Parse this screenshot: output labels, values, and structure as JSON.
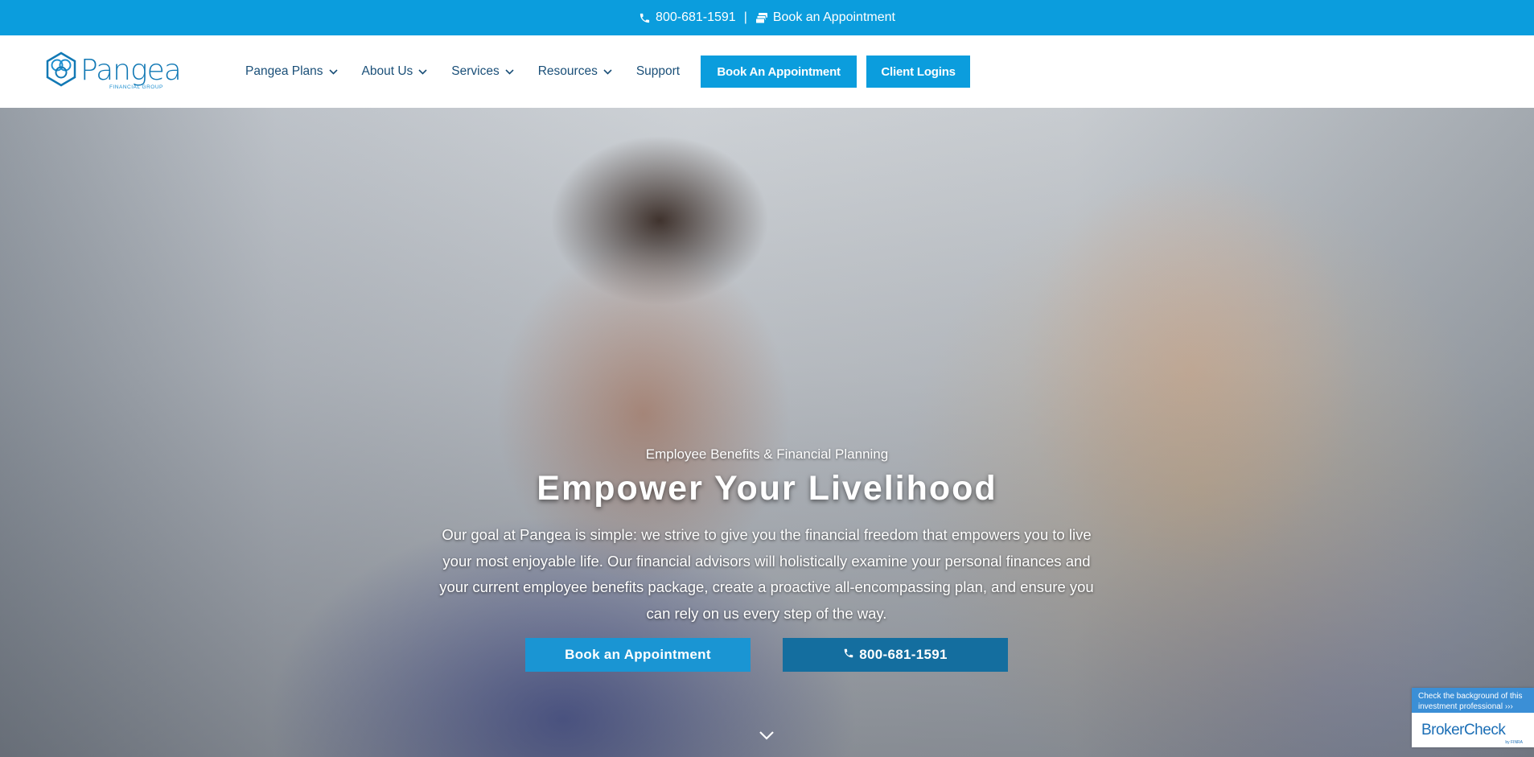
{
  "topbar": {
    "phone": "800-681-1591",
    "separator": "|",
    "appointment": "Book an Appointment"
  },
  "header": {
    "logo": {
      "brand": "Pangea",
      "subtitle": "FINANCIAL GROUP"
    },
    "nav": [
      {
        "label": "Pangea Plans",
        "has_dropdown": true
      },
      {
        "label": "About Us",
        "has_dropdown": true
      },
      {
        "label": "Services",
        "has_dropdown": true
      },
      {
        "label": "Resources",
        "has_dropdown": true
      },
      {
        "label": "Support",
        "has_dropdown": false
      }
    ],
    "cta_appointment": "Book An Appointment",
    "cta_logins": "Client Logins"
  },
  "hero": {
    "eyebrow": "Employee Benefits & Financial Planning",
    "title": "Empower Your Livelihood",
    "description": "Our goal at Pangea is simple: we strive to give you the financial freedom that empowers you to live your most enjoyable life. Our financial advisors will holistically examine your personal finances and your current employee benefits package, create a proactive all-encompassing plan, and ensure you can rely on us every step of the way.",
    "btn_appointment": "Book an Appointment",
    "btn_phone": "800-681-1591",
    "background": "photo-couple-laptop"
  },
  "brokercheck": {
    "text": "Check the background of this investment professional",
    "arrows": "›››",
    "logo": "BrokerCheck",
    "by": "by FINRA"
  },
  "colors": {
    "brand_blue": "#0b9ddd",
    "nav_text": "#1a4f78",
    "phone_button": "#146e9f",
    "logo_blue": "#1279b5"
  }
}
